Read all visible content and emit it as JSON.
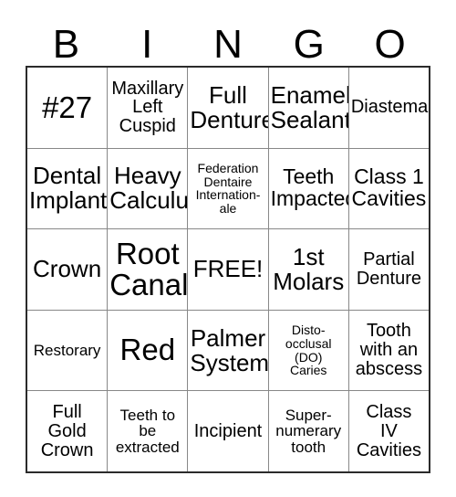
{
  "card": {
    "title": "BINGO",
    "header_letters": [
      "B",
      "I",
      "N",
      "G",
      "O"
    ],
    "columns": 5,
    "rows": 5,
    "free_space": "FREE!",
    "colors": {
      "background": "#ffffff",
      "text": "#000000",
      "outer_border": "#2b2b2b",
      "inner_border": "#888888"
    },
    "cells": [
      [
        {
          "text": "#27",
          "size": "xxl"
        },
        {
          "text": "Maxillary\nLeft\nCuspid",
          "size": "md"
        },
        {
          "text": "Full\nDenture",
          "size": "xl"
        },
        {
          "text": "Enamel\nSealant",
          "size": "xl"
        },
        {
          "text": "Diastema",
          "size": "md"
        }
      ],
      [
        {
          "text": "Dental\nImplant",
          "size": "xl"
        },
        {
          "text": "Heavy\nCalculus",
          "size": "xl"
        },
        {
          "text": "Federation\nDentaire\nInternation-\nale",
          "size": "xs"
        },
        {
          "text": "Teeth\nImpacted",
          "size": "lg"
        },
        {
          "text": "Class 1\nCavities",
          "size": "lg"
        }
      ],
      [
        {
          "text": "Crown",
          "size": "xl"
        },
        {
          "text": "Root\nCanal",
          "size": "xxl"
        },
        {
          "text": "FREE!",
          "size": "xl"
        },
        {
          "text": "1st\nMolars",
          "size": "xl"
        },
        {
          "text": "Partial\nDenture",
          "size": "md"
        }
      ],
      [
        {
          "text": "Restorary",
          "size": "sm"
        },
        {
          "text": "Red",
          "size": "xxl"
        },
        {
          "text": "Palmer\nSystem",
          "size": "xl"
        },
        {
          "text": "Disto-\nocclusal\n(DO)\nCaries",
          "size": "xs"
        },
        {
          "text": "Tooth\nwith an\nabscess",
          "size": "md"
        }
      ],
      [
        {
          "text": "Full\nGold\nCrown",
          "size": "md"
        },
        {
          "text": "Teeth to\nbe\nextracted",
          "size": "sm"
        },
        {
          "text": "Incipient",
          "size": "md"
        },
        {
          "text": "Super-\nnumerary\ntooth",
          "size": "sm"
        },
        {
          "text": "Class\nIV\nCavities",
          "size": "md"
        }
      ]
    ]
  }
}
